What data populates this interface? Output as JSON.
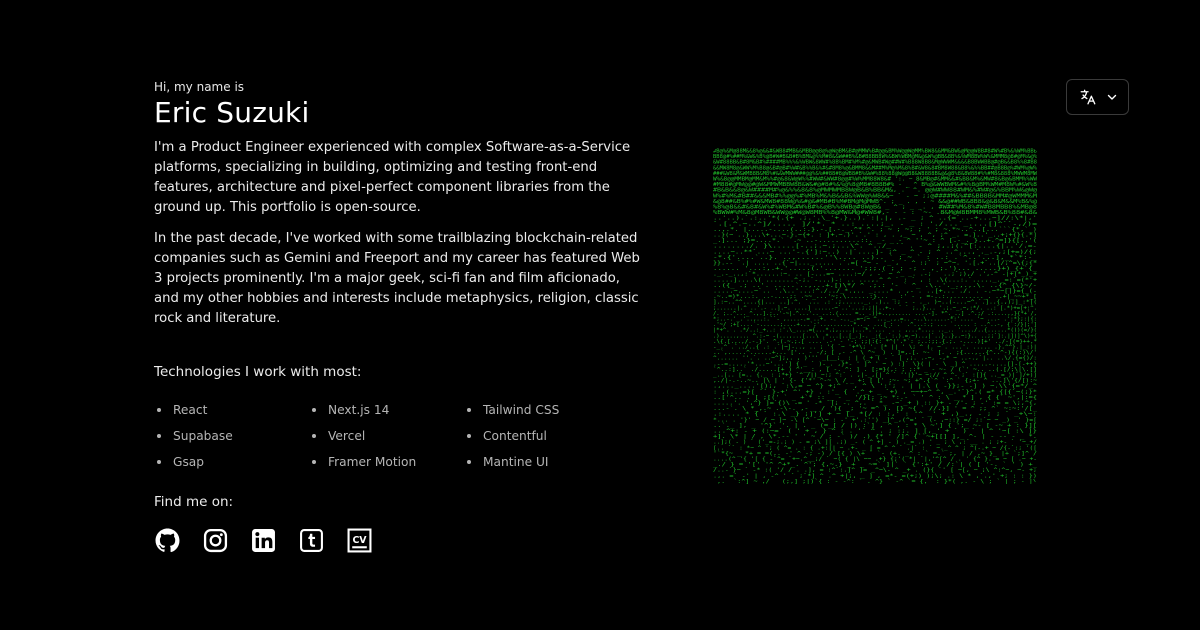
{
  "intro": {
    "greeting": "Hi, my name is",
    "name": "Eric Suzuki",
    "paragraph_1": "I'm a Product Engineer experienced with complex Software-as-a-Service platforms, specializing in building, optimizing and testing front-end features, architecture and pixel-perfect component libraries from the ground up. This portfolio is open-source.",
    "paragraph_2": "In the past decade, I've worked with some trailblazing blockchain-related companies such as Gemini and Freeport and my career has featured Web 3 projects prominently. I'm a major geek, sci-fi fan and film aficionado, and my other hobbies and interests include metaphysics, religion, classic rock and literature."
  },
  "technologies": {
    "heading": "Technologies I work with most:",
    "items": [
      "React",
      "Next.js 14",
      "Tailwind CSS",
      "Supabase",
      "Vercel",
      "Contentful",
      "Gsap",
      "Framer Motion",
      "Mantine UI"
    ]
  },
  "find_me": {
    "heading": "Find me on:",
    "links": [
      {
        "icon": "github-icon"
      },
      {
        "icon": "instagram-icon"
      },
      {
        "icon": "linkedin-icon"
      },
      {
        "icon": "tumblr-icon"
      },
      {
        "icon": "cv-icon",
        "label": "CV"
      }
    ]
  },
  "language_switcher": {
    "icon": "translate-icon",
    "chevron": "chevron-down-icon"
  },
  "portrait": {
    "style": "ascii-art-portrait",
    "color": "#1fbf2a"
  },
  "colors": {
    "background": "#000000",
    "text": "#ffffff",
    "muted_text": "#b5b5b5",
    "ascii_green": "#1fbf2a"
  }
}
